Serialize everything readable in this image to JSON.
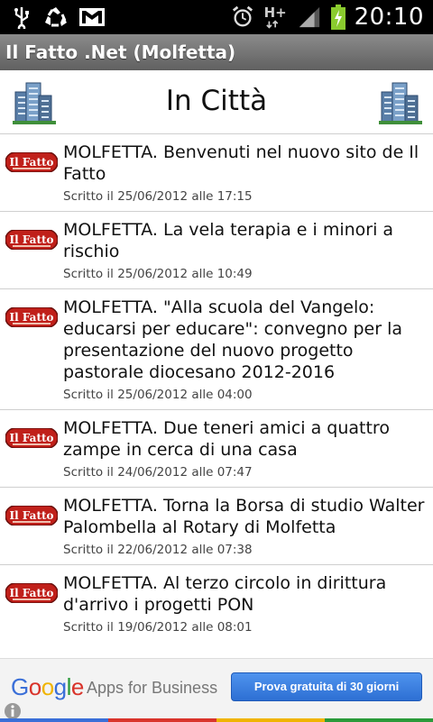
{
  "status_bar": {
    "time": "20:10",
    "network": "H+"
  },
  "app": {
    "title": "Il Fatto .Net (Molfetta)"
  },
  "section": {
    "title": "In Città"
  },
  "articles": [
    {
      "headline": "MOLFETTA. Benvenuti nel nuovo sito de Il Fatto",
      "date": "Scritto il 25/06/2012 alle 17:15"
    },
    {
      "headline": "MOLFETTA. La vela terapia e i minori a rischio",
      "date": "Scritto il 25/06/2012 alle 10:49"
    },
    {
      "headline": "MOLFETTA. \"Alla scuola del Vangelo: educarsi per educare\": convegno per la presentazione del nuovo progetto pastorale diocesano 2012-2016",
      "date": "Scritto il 25/06/2012 alle 04:00"
    },
    {
      "headline": "MOLFETTA. Due teneri amici a quattro zampe in cerca di una casa",
      "date": "Scritto il 24/06/2012 alle 07:47"
    },
    {
      "headline": "MOLFETTA. Torna la Borsa di studio Walter Palombella al Rotary di Molfetta",
      "date": "Scritto il 22/06/2012 alle 07:38"
    },
    {
      "headline": "MOLFETTA. Al terzo circolo in dirittura d'arrivo i progetti PON",
      "date": "Scritto il 19/06/2012 alle 08:01"
    }
  ],
  "ad": {
    "brand": "Google",
    "product": "Apps for Business",
    "cta": "Prova gratuita di 30 giorni"
  },
  "colors": {
    "status_bar": "#000000",
    "title_bar": "#707070",
    "logo_red": "#c0201a",
    "cta_blue": "#3a7fe0"
  }
}
